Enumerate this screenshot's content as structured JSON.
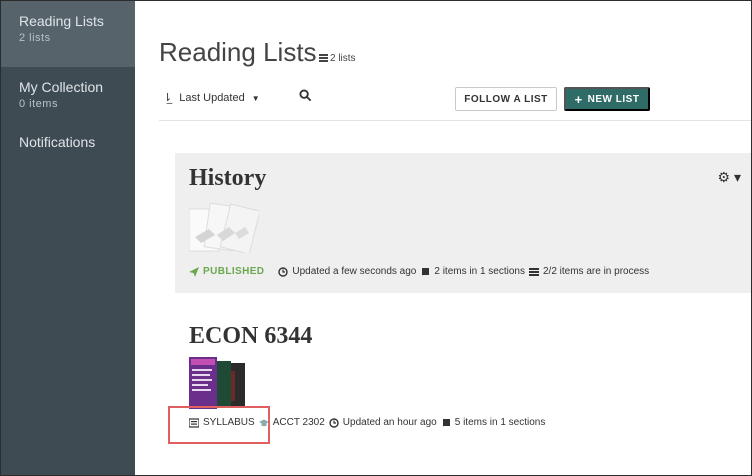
{
  "sidebar": {
    "items": [
      {
        "label": "Reading Lists",
        "sub": "2 lists"
      },
      {
        "label": "My Collection",
        "sub": "0 items"
      },
      {
        "label": "Notifications",
        "sub": ""
      }
    ]
  },
  "header": {
    "title": "Reading Lists",
    "count": "2 lists"
  },
  "toolbar": {
    "sort_label": "Last Updated",
    "follow_label": "FOLLOW A LIST",
    "new_label": "NEW LIST"
  },
  "lists": [
    {
      "title": "History",
      "status": "PUBLISHED",
      "updated": "Updated a few seconds ago",
      "items": "2 items in 1 sections",
      "process": "2/2 items are in process"
    },
    {
      "title": "ECON 6344",
      "type": "SYLLABUS",
      "course": "ACCT 2302",
      "updated": "Updated an hour ago",
      "items": "5 items in 1 sections"
    }
  ],
  "colors": {
    "sidebar_bg": "#3f4b52",
    "sidebar_active": "#56636a",
    "accent": "#2f6b67",
    "published": "#6aa84f",
    "highlight": "#e06060"
  }
}
